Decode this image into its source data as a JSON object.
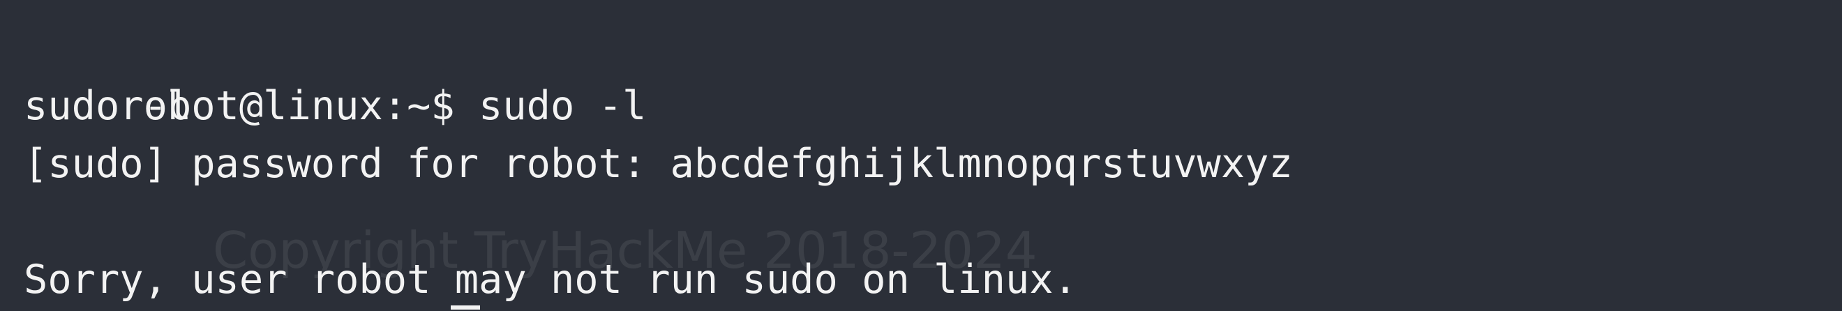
{
  "terminal": {
    "lines": [
      {
        "prompt": "robot@linux:~$ ",
        "command": "sudo -l"
      },
      {
        "text": "sudo -l"
      },
      {
        "text": "[sudo] password for robot: abcdefghijklmnopqrstuvwxyz"
      },
      {
        "text": ""
      },
      {
        "text": "Sorry, user robot may not run sudo on linux."
      }
    ],
    "watermark": "Copyright TryHackMe 2018-2024"
  },
  "colors": {
    "background": "#2b2f38",
    "foreground": "#f3f3f3"
  }
}
